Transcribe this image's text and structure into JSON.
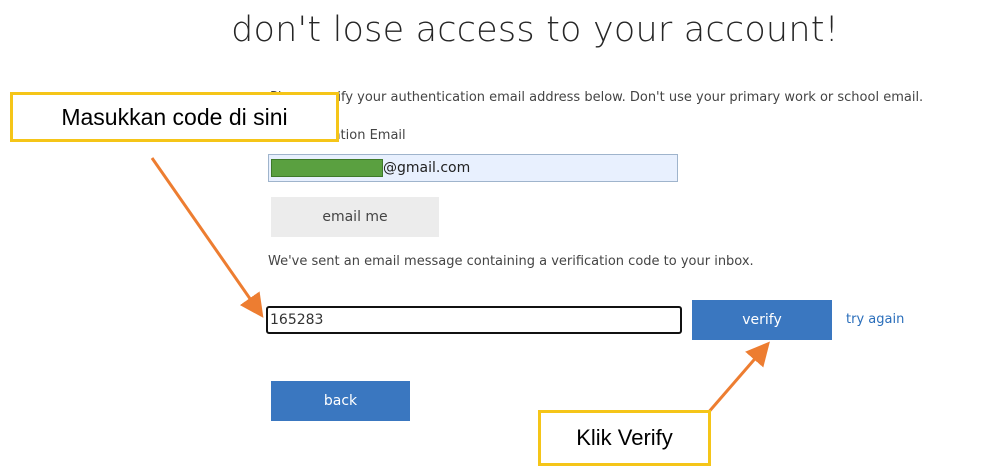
{
  "page": {
    "title": "don't lose access to your account!"
  },
  "form": {
    "instruction": "Please verify your authentication email address below. Don't use your primary work or school email.",
    "email_label": "Authentication Email",
    "email_value_suffix": "@gmail.com",
    "email_me_label": "email me",
    "sent_message": "We've sent an email message containing a verification code to your inbox.",
    "code_value": "165283",
    "verify_label": "verify",
    "try_again_label": "try again",
    "back_label": "back"
  },
  "annotations": {
    "code_callout": "Masukkan code di sini",
    "verify_callout": "Klik Verify"
  },
  "colors": {
    "primary_button": "#3a77c0",
    "callout_border": "#f5c518",
    "arrow": "#ed7d31",
    "redaction": "#5aa040"
  }
}
